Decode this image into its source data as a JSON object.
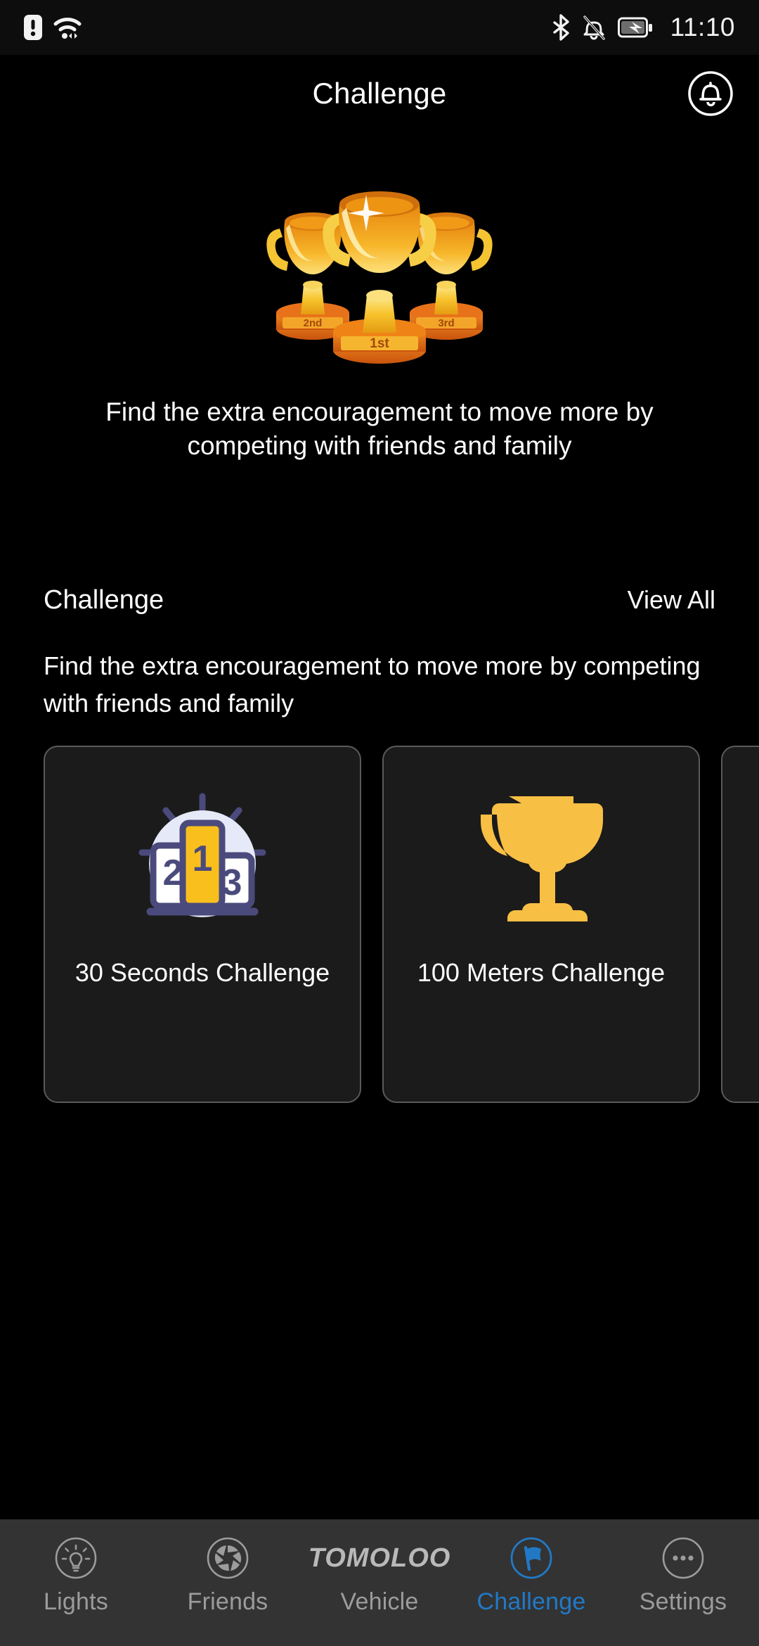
{
  "statusbar": {
    "time": "11:10",
    "left_icons": [
      "sim-alert-icon",
      "wifi-icon"
    ],
    "right_icons": [
      "bluetooth-icon",
      "notifications-muted-icon",
      "battery-charging-icon"
    ]
  },
  "header": {
    "title": "Challenge",
    "bell_icon": "notification-bell-icon"
  },
  "hero": {
    "art": "three-trophies-illustration",
    "trophy_ranks": [
      "2nd",
      "1st",
      "3rd"
    ],
    "text": "Find the extra encouragement to move more by competing with friends and family"
  },
  "section": {
    "title": "Challenge",
    "view_all": "View All",
    "description": "Find the extra encouragement to move more by competing with friends and family"
  },
  "cards": [
    {
      "label": "30 Seconds\nChallenge",
      "icon": "podium-ranking-icon",
      "podium_numbers": [
        "2",
        "1",
        "3"
      ]
    },
    {
      "label": "100 Meters\nChallenge",
      "icon": "trophy-icon"
    },
    {
      "label": "",
      "icon": ""
    }
  ],
  "navbar": {
    "items": [
      {
        "label": "Lights",
        "icon": "lightbulb-icon",
        "active": false
      },
      {
        "label": "Friends",
        "icon": "aperture-icon",
        "active": false
      },
      {
        "label": "Vehicle",
        "icon": "tomoloo-logo",
        "logo_text": "TOMOLOO",
        "active": false
      },
      {
        "label": "Challenge",
        "icon": "flag-icon",
        "active": true
      },
      {
        "label": "Settings",
        "icon": "more-dots-icon",
        "active": false
      }
    ]
  },
  "colors": {
    "background": "#000000",
    "navbar_bg": "#333333",
    "card_bg": "#1b1b1b",
    "card_border": "#5a5a5a",
    "accent_blue": "#2179c6",
    "trophy_yellow": "#f8bf45",
    "podium_purple": "#4a4a7c",
    "inactive_gray": "#9c9c9c"
  }
}
